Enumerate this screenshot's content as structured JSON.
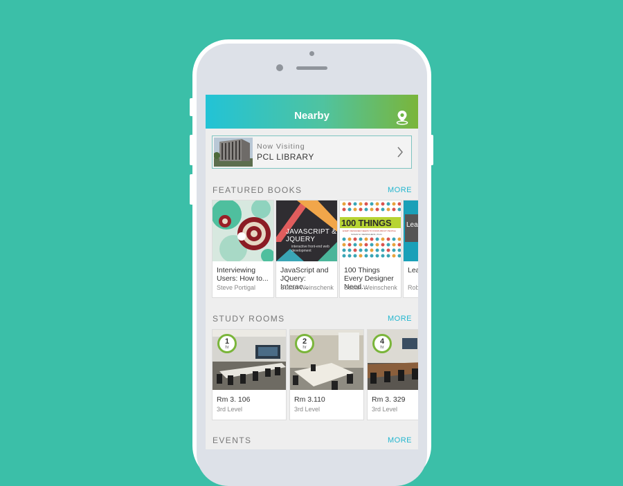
{
  "nav": {
    "title": "Nearby",
    "icon": "map-pin-icon"
  },
  "now_visiting": {
    "label": "Now Visiting",
    "place": "PCL LIBRARY"
  },
  "featured_books": {
    "title": "FEATURED BOOKS",
    "more": "MORE",
    "items": [
      {
        "title": "Interviewing Users: How to...",
        "author": "Steve Portigal"
      },
      {
        "title": "JavaScript and JQuery: Interac...",
        "author": "Susan Weinschenk",
        "cover_title": "JAVASCRIPT & JQUERY",
        "cover_subtitle": "interactive front-end web development"
      },
      {
        "title": "100 Things Every Designer Need...",
        "author": "Susan Weinschenk",
        "cover_title": "100 THINGS",
        "cover_subtitle": "EVERY DESIGNER NEEDS TO KNOW ABOUT PEOPLE",
        "cover_author": "SUSAN M. WEINSCHENK, PH.D."
      },
      {
        "title": "Lea... MyS...",
        "author": "Robi...",
        "cover_title": "Learn PHP & J"
      }
    ]
  },
  "study_rooms": {
    "title": "STUDY ROOMS",
    "more": "MORE",
    "items": [
      {
        "hours": "1",
        "unit": "hr",
        "room": "Rm 3. 106",
        "level": "3rd Level"
      },
      {
        "hours": "2",
        "unit": "hr",
        "room": "Rm 3.110",
        "level": "3rd Level"
      },
      {
        "hours": "4",
        "unit": "hr",
        "room": "Rm 3. 329",
        "level": "3rd Level"
      }
    ]
  },
  "events": {
    "title": "EVENTS",
    "more": "MORE"
  },
  "colors": {
    "background": "#3bbfa8",
    "accent": "#22b6cf",
    "badge": "#7ab53a",
    "gradient_start": "#22c3d6",
    "gradient_end": "#7ab53a"
  }
}
